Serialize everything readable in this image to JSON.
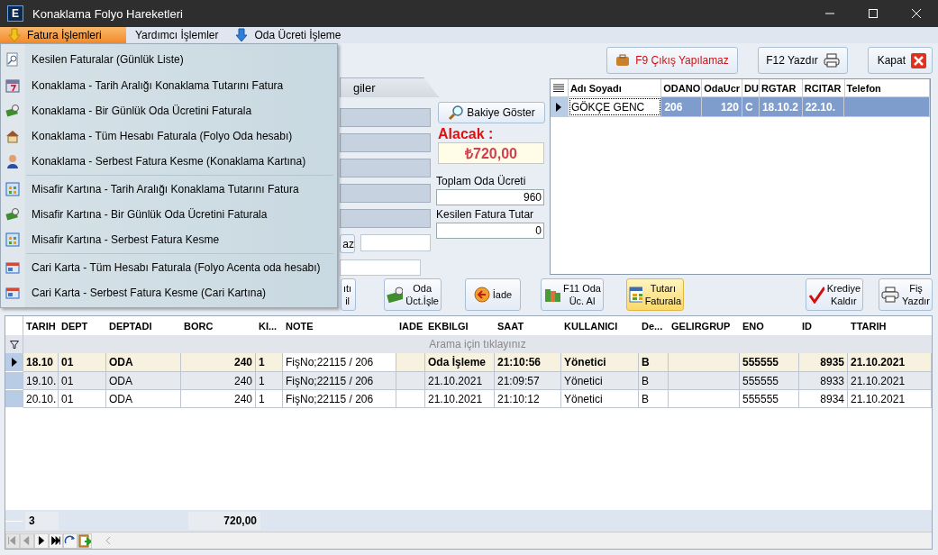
{
  "window": {
    "title": "Konaklama Folyo Hareketleri",
    "logo": "E"
  },
  "menubar": [
    {
      "label": "Fatura İşlemleri",
      "selected": true
    },
    {
      "label": "Yardımcı İşlemler",
      "selected": false
    },
    {
      "label": "Oda Ücreti İşleme",
      "selected": false
    }
  ],
  "menu": [
    {
      "kind": "item",
      "label": "Kesilen Faturalar (Günlük Liste)"
    },
    {
      "kind": "item",
      "label": "Konaklama -  Tarih Aralığı Konaklama Tutarını Fatura"
    },
    {
      "kind": "item",
      "label": "Konaklama  - Bir Günlük  Oda Ücretini Faturala"
    },
    {
      "kind": "item",
      "label": "Konaklama -  Tüm Hesabı Faturala (Folyo Oda hesabı)"
    },
    {
      "kind": "item",
      "label": "Konaklama - Serbest Fatura Kesme (Konaklama Kartına)"
    },
    {
      "kind": "separator"
    },
    {
      "kind": "item",
      "label": "Misafir Kartına -  Tarih Aralığı Konaklama Tutarını Fatura"
    },
    {
      "kind": "item",
      "label": "Misafir Kartına - Bir Günlük Oda Ücretini Faturala"
    },
    {
      "kind": "item",
      "label": "Misafir Kartına - Serbest Fatura Kesme"
    },
    {
      "kind": "separator"
    },
    {
      "kind": "item",
      "label": "Cari Karta - Tüm Hesabı Faturala (Folyo Acenta oda hesabı)"
    },
    {
      "kind": "item",
      "label": "Cari Karta  - Serbest Fatura Kesme (Cari Kartına)"
    }
  ],
  "toolbar": [
    {
      "label": "F9 Çıkış Yapılamaz",
      "kind": "exit"
    },
    {
      "label": "F12 Yazdır",
      "kind": "print"
    },
    {
      "label": "Kapat",
      "kind": "close"
    }
  ],
  "tab": {
    "label": "giler"
  },
  "side_button": {
    "label": "az"
  },
  "balance": {
    "button": "Bakiye Göster",
    "label": "Alacak :",
    "amount": "₺720,00",
    "total_label": "Toplam Oda Ücreti",
    "total": "960",
    "invoiced_label": "Kesilen Fatura Tutar",
    "invoiced": "0"
  },
  "guests": {
    "columns": [
      "Adı Soyadı",
      "ODANO",
      "OdaUcr",
      "DU",
      "RGTAR",
      "RCITAR",
      "Telefon"
    ],
    "rows": [
      {
        "selected": true,
        "cells": [
          "GÖKÇE GENC",
          "206",
          "120",
          "C",
          "18.10.2",
          "22.10.",
          ""
        ]
      }
    ]
  },
  "actions": [
    {
      "label": "ıtı\nil",
      "kind": "none",
      "highlighted": false
    },
    {
      "label": "Oda\nÜct.İşle",
      "kind": "money",
      "highlighted": false
    },
    {
      "label": "İade",
      "kind": "return",
      "highlighted": false
    },
    {
      "label": "F11 Oda\nÜc. Al",
      "kind": "cash",
      "highlighted": false
    },
    {
      "label": "Tutarı\nFaturala",
      "kind": "invoice",
      "highlighted": true
    },
    {
      "label": "Krediye\nKaldır",
      "kind": "check",
      "highlighted": false
    },
    {
      "label": "Fiş\nYazdır",
      "kind": "print",
      "highlighted": false
    }
  ],
  "table": {
    "columns": [
      "TARIH",
      "DEPT",
      "DEPTADI",
      "BORC",
      "KI...",
      "NOTE",
      "IADE",
      "EKBILGI",
      "SAAT",
      "KULLANICI",
      "De...",
      "GELIRGRUP",
      "ENO",
      "ID",
      "TTARIH"
    ],
    "filter_placeholder": "Arama için tıklayınız",
    "rows": [
      {
        "selected": true,
        "cells": [
          "18.10",
          "01",
          "ODA",
          "240",
          "1",
          "FişNo;22115 / 206",
          "",
          "Oda İşleme",
          "21:10:56",
          "Yönetici",
          "B",
          "",
          "555555",
          "8935",
          "21.10.2021"
        ]
      },
      {
        "selected": false,
        "cells": [
          "19.10.",
          "01",
          "ODA",
          "240",
          "1",
          "FişNo;22115 / 206",
          "",
          "21.10.2021",
          "21:09:57",
          "Yönetici",
          "B",
          "",
          "555555",
          "8933",
          "21.10.2021"
        ]
      },
      {
        "selected": false,
        "cells": [
          "20.10.",
          "01",
          "ODA",
          "240",
          "1",
          "FişNo;22115 / 206",
          "",
          "21.10.2021",
          "21:10:12",
          "Yönetici",
          "B",
          "",
          "555555",
          "8934",
          "21.10.2021"
        ]
      }
    ],
    "footer": {
      "count": "3",
      "total": "720,00"
    }
  },
  "navigator": [
    {
      "kind": "first",
      "disabled": true
    },
    {
      "kind": "prev",
      "disabled": true
    },
    {
      "kind": "next",
      "disabled": false
    },
    {
      "kind": "last",
      "disabled": false
    },
    {
      "kind": "refresh",
      "disabled": false
    },
    {
      "kind": "export",
      "disabled": false
    }
  ]
}
